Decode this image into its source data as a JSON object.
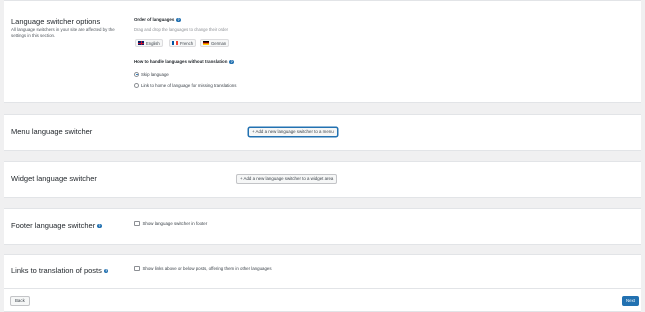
{
  "colors": {
    "primary": "#2271b1",
    "background": "#f0f0f1",
    "panel": "#ffffff"
  },
  "switcher_options": {
    "title": "Language switcher options",
    "description": "All language switchers in your site are affected by the settings in this section.",
    "order": {
      "label": "Order of languages",
      "hint": "Drag and drop the languages to change their order",
      "languages": [
        {
          "name": "English",
          "flag": "uk-flag"
        },
        {
          "name": "French",
          "flag": "fr-flag"
        },
        {
          "name": "German",
          "flag": "de-flag"
        }
      ]
    },
    "missing": {
      "label": "How to handle languages without translation",
      "options": [
        {
          "label": "Skip language",
          "selected": true
        },
        {
          "label": "Link to home of language for missing translations",
          "selected": false
        }
      ]
    }
  },
  "menu": {
    "title": "Menu language switcher",
    "button": "+ Add a new language switcher to a menu"
  },
  "widget": {
    "title": "Widget language switcher",
    "button": "+ Add a new language switcher to a widget area"
  },
  "footer": {
    "title": "Footer language switcher",
    "checkbox": "Show language switcher in footer",
    "checked": false
  },
  "posts": {
    "title": "Links to translation of posts",
    "checkbox": "Show links above or below posts, offering them in other languages",
    "checked": false
  },
  "nav": {
    "back": "Back",
    "next": "Next"
  }
}
